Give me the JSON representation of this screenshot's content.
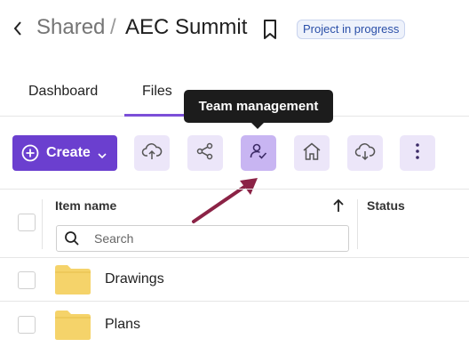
{
  "header": {
    "breadcrumb_parent": "Shared",
    "breadcrumb_separator": "/",
    "title": "AEC Summit",
    "status_badge": "Project in progress"
  },
  "tabs": [
    {
      "label": "Dashboard",
      "active": false
    },
    {
      "label": "Files",
      "active": true
    }
  ],
  "tooltip": {
    "text": "Team management"
  },
  "toolbar": {
    "create_label": "Create",
    "buttons": [
      {
        "icon": "cloud-upload-icon"
      },
      {
        "icon": "share-icon"
      },
      {
        "icon": "team-management-icon",
        "active": true
      },
      {
        "icon": "home-icon"
      },
      {
        "icon": "cloud-download-icon"
      },
      {
        "icon": "more-vertical-icon"
      }
    ]
  },
  "table": {
    "columns": {
      "name": "Item name",
      "status": "Status"
    },
    "search_placeholder": "Search",
    "rows": [
      {
        "name": "Drawings",
        "type": "folder"
      },
      {
        "name": "Plans",
        "type": "folder"
      }
    ]
  },
  "colors": {
    "accent": "#6b3fcf",
    "active_tool": "#c8b5f2",
    "tool_bg": "#ece6f9",
    "folder": "#f5d36a",
    "annotation_arrow": "#8b2346"
  }
}
